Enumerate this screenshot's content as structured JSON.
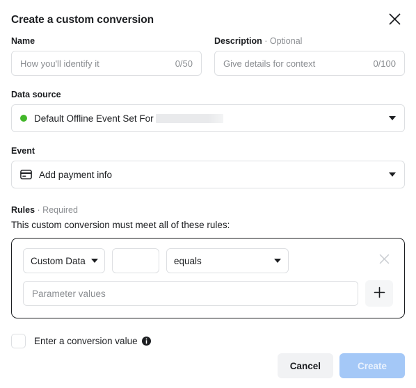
{
  "dialog": {
    "title": "Create a custom conversion",
    "close_icon": "close-icon"
  },
  "name_field": {
    "label": "Name",
    "placeholder": "How you'll identify it",
    "counter": "0/50",
    "value": ""
  },
  "description_field": {
    "label": "Description",
    "label_suffix": "· Optional",
    "placeholder": "Give details for context",
    "counter": "0/100",
    "value": ""
  },
  "data_source": {
    "label": "Data source",
    "status_icon": "green-status-dot",
    "value": "Default Offline Event Set For",
    "redacted": true,
    "caret_icon": "chevron-down-icon"
  },
  "event": {
    "label": "Event",
    "icon": "credit-card-icon",
    "value": "Add payment info",
    "caret_icon": "chevron-down-icon"
  },
  "rules": {
    "label": "Rules",
    "label_suffix": "· Required",
    "description": "This custom conversion must meet all of these rules:",
    "row": {
      "field_select": "Custom Data",
      "param_name_value": "",
      "operator_select": "equals",
      "remove_icon": "close-icon",
      "parameter_values_placeholder": "Parameter values",
      "parameter_values": "",
      "add_icon": "plus-icon"
    }
  },
  "conversion_value": {
    "checked": false,
    "label": "Enter a conversion value",
    "info_icon": "info-icon"
  },
  "footer": {
    "cancel_label": "Cancel",
    "create_label": "Create",
    "create_disabled": true
  },
  "colors": {
    "status_green": "#42b72a",
    "primary_blue_disabled": "#a4c8f7",
    "cancel_gray": "#f1f2f4",
    "border": "#dddfe2",
    "text": "#1c1e21",
    "muted_text": "#8a8d91"
  }
}
